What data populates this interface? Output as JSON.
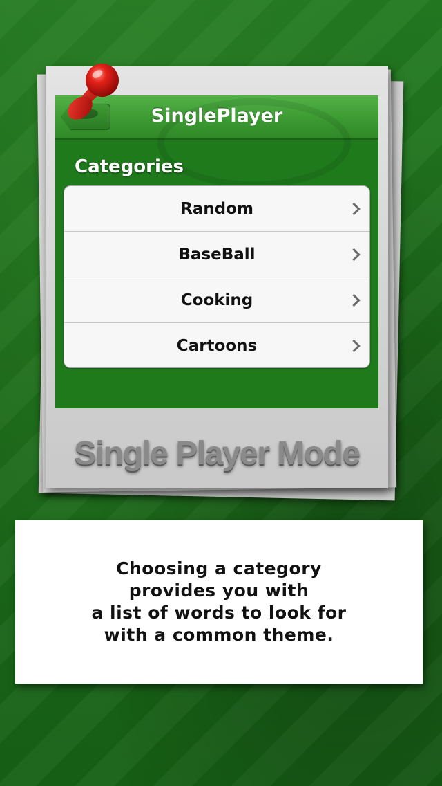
{
  "navbar": {
    "title": "SinglePlayer"
  },
  "categories": {
    "header": "Categories",
    "items": [
      {
        "label": "Random"
      },
      {
        "label": "BaseBall"
      },
      {
        "label": "Cooking"
      },
      {
        "label": "Cartoons"
      }
    ]
  },
  "caption": "Single Player Mode",
  "info": {
    "lines": [
      "Choosing a category",
      "provides you with",
      "a list of words to look for",
      "with a common theme."
    ]
  },
  "icons": {
    "pin": "push-pin-icon",
    "chevron": "chevron-right-icon",
    "back": "back-arrow-icon"
  },
  "colors": {
    "background": "#1e6b1c",
    "navbar": "#3c9a32",
    "pin": "#d8140f"
  }
}
